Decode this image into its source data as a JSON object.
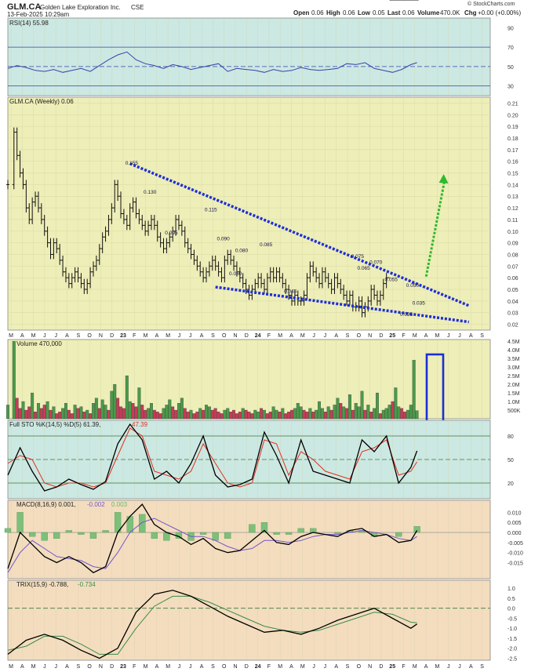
{
  "header": {
    "symbol": "GLM.CA",
    "company": "Golden Lake Exploration Inc.",
    "exchange": "CSE",
    "datetime": "13-Feb-2025 10:29am",
    "open_label": "Open",
    "open": "0.06",
    "high_label": "High",
    "high": "0.06",
    "low_label": "Low",
    "low": "0.05",
    "last_label": "Last",
    "last": "0.06",
    "volume_label": "Volume",
    "volume": "470.0K",
    "chg_label": "Chg",
    "chg": "+0.00 (+0.00%)",
    "copyright": "© StockCharts.com"
  },
  "x_axis": {
    "labels": [
      "M",
      "A",
      "M",
      "J",
      "J",
      "A",
      "S",
      "O",
      "N",
      "D",
      "23",
      "F",
      "M",
      "A",
      "M",
      "J",
      "J",
      "A",
      "S",
      "O",
      "N",
      "D",
      "24",
      "F",
      "M",
      "A",
      "M",
      "J",
      "J",
      "A",
      "S",
      "O",
      "N",
      "D",
      "25",
      "F",
      "M",
      "A",
      "M",
      "J",
      "J",
      "A",
      "S"
    ],
    "bold_labels": [
      "23",
      "24",
      "25"
    ]
  },
  "colors": {
    "price_bg": "#eeeeb8",
    "rsi_bg": "#cce8e2",
    "osc_bg": "#f3ddbe",
    "trend": "#1e2ed8",
    "arrow": "#2fb82f",
    "up": "#4a9a4a",
    "down": "#c63c58",
    "rsi_line": "#3344aa",
    "k_line": "#000000",
    "d_line": "#e03020",
    "hist": "#7cc07a",
    "macd_sig": "#7755cc",
    "trix_sig": "#3a8a4a"
  },
  "chart_data": [
    {
      "type": "line",
      "panel": "rsi",
      "legend": "RSI(14) 55.98",
      "ylim": [
        20,
        100
      ],
      "ticks": [
        30,
        50,
        70,
        90
      ],
      "levels": [
        30,
        50,
        70
      ],
      "x": [
        0,
        3,
        6,
        9,
        12,
        15,
        18,
        21,
        24,
        27,
        30,
        33,
        36,
        39,
        42,
        45,
        48,
        51,
        54,
        57,
        60,
        63,
        66,
        69,
        72,
        75,
        78,
        81,
        84,
        87,
        90,
        93,
        96,
        99,
        102,
        105,
        108,
        111,
        114,
        117,
        120,
        123,
        126,
        129,
        132,
        134
      ],
      "values": [
        48,
        51,
        49,
        46,
        45,
        47,
        44,
        46,
        48,
        45,
        51,
        57,
        62,
        65,
        57,
        53,
        51,
        48,
        52,
        50,
        47,
        49,
        51,
        53,
        45,
        48,
        47,
        46,
        44,
        47,
        45,
        46,
        49,
        47,
        46,
        47,
        48,
        53,
        52,
        54,
        48,
        46,
        44,
        47,
        52,
        54
      ]
    },
    {
      "type": "line",
      "panel": "price",
      "legend": "GLM.CA (Weekly) 0.06",
      "ylim": [
        0.015,
        0.215
      ],
      "ticks": [
        0.02,
        0.03,
        0.04,
        0.05,
        0.06,
        0.07,
        0.08,
        0.09,
        0.1,
        0.11,
        0.12,
        0.13,
        0.14,
        0.15,
        0.16,
        0.17,
        0.18,
        0.19,
        0.2,
        0.21
      ],
      "x": [
        0,
        2,
        3,
        4,
        5,
        6,
        7,
        8,
        9,
        10,
        11,
        12,
        13,
        14,
        15,
        16,
        17,
        18,
        19,
        20,
        21,
        22,
        23,
        24,
        25,
        26,
        27,
        28,
        29,
        30,
        31,
        32,
        33,
        34,
        35,
        36,
        37,
        38,
        39,
        40,
        41,
        42,
        43,
        44,
        45,
        46,
        47,
        48,
        49,
        50,
        51,
        52,
        53,
        54,
        55,
        56,
        57,
        58,
        59,
        60,
        61,
        62,
        63,
        64,
        65,
        66,
        67,
        68,
        69,
        70,
        71,
        72,
        73,
        74,
        75,
        76,
        77,
        78,
        79,
        80,
        81,
        82,
        83,
        84,
        85,
        86,
        87,
        88,
        89,
        90,
        91,
        92,
        93,
        94,
        95,
        96,
        97,
        98,
        99,
        100,
        101,
        102,
        103,
        104,
        105,
        106,
        107,
        108,
        109,
        110,
        111,
        112,
        113,
        114,
        115,
        116,
        117,
        118,
        119,
        120,
        121,
        122,
        123,
        124,
        125,
        126,
        127,
        128,
        129,
        130,
        131,
        132,
        133,
        134
      ],
      "values": [
        0.14,
        0.185,
        0.165,
        0.15,
        0.14,
        0.12,
        0.11,
        0.125,
        0.13,
        0.12,
        0.11,
        0.1,
        0.09,
        0.08,
        0.09,
        0.085,
        0.075,
        0.065,
        0.06,
        0.055,
        0.06,
        0.065,
        0.06,
        0.055,
        0.05,
        0.055,
        0.065,
        0.07,
        0.075,
        0.085,
        0.095,
        0.1,
        0.11,
        0.12,
        0.14,
        0.13,
        0.115,
        0.11,
        0.105,
        0.12,
        0.125,
        0.115,
        0.11,
        0.105,
        0.1,
        0.105,
        0.11,
        0.105,
        0.095,
        0.09,
        0.085,
        0.09,
        0.095,
        0.1,
        0.11,
        0.105,
        0.1,
        0.09,
        0.085,
        0.08,
        0.075,
        0.07,
        0.065,
        0.06,
        0.065,
        0.07,
        0.075,
        0.07,
        0.065,
        0.06,
        0.075,
        0.08,
        0.075,
        0.07,
        0.065,
        0.06,
        0.055,
        0.05,
        0.045,
        0.05,
        0.055,
        0.06,
        0.055,
        0.05,
        0.06,
        0.065,
        0.06,
        0.065,
        0.06,
        0.055,
        0.05,
        0.045,
        0.04,
        0.045,
        0.04,
        0.04,
        0.045,
        0.06,
        0.07,
        0.065,
        0.06,
        0.055,
        0.065,
        0.06,
        0.055,
        0.05,
        0.06,
        0.055,
        0.05,
        0.045,
        0.04,
        0.045,
        0.035,
        0.035,
        0.04,
        0.03,
        0.035,
        0.04,
        0.05,
        0.045,
        0.04,
        0.045,
        0.055,
        0.06
      ],
      "annotations": [
        {
          "x": 40,
          "y": 0.155,
          "label": "0.155"
        },
        {
          "x": 46,
          "y": 0.13,
          "label": "0.130"
        },
        {
          "x": 53,
          "y": 0.095,
          "label": "0.095"
        },
        {
          "x": 66,
          "y": 0.115,
          "label": "0.115"
        },
        {
          "x": 70,
          "y": 0.09,
          "label": "0.090"
        },
        {
          "x": 76,
          "y": 0.08,
          "label": "0.080"
        },
        {
          "x": 74,
          "y": 0.06,
          "label": "0.060"
        },
        {
          "x": 84,
          "y": 0.085,
          "label": "0.085"
        },
        {
          "x": 92,
          "y": 0.045,
          "label": "0.045"
        },
        {
          "x": 114,
          "y": 0.075,
          "label": "0.075"
        },
        {
          "x": 116,
          "y": 0.065,
          "label": "0.065"
        },
        {
          "x": 120,
          "y": 0.07,
          "label": "0.070"
        },
        {
          "x": 125,
          "y": 0.055,
          "label": "0.055"
        },
        {
          "x": 132,
          "y": 0.05,
          "label": "0.050"
        },
        {
          "x": 134,
          "y": 0.035,
          "label": "0.035"
        },
        {
          "x": 130,
          "y": 0.025,
          "label": "0.025"
        }
      ],
      "trendlines": [
        {
          "x1": 40,
          "y1": 0.158,
          "x2": 151,
          "y2": 0.036
        },
        {
          "x1": 68,
          "y1": 0.052,
          "x2": 151,
          "y2": 0.022
        }
      ],
      "arrow": {
        "x1": 137,
        "y1": 0.061,
        "x2": 143,
        "y2": 0.147
      }
    },
    {
      "type": "bar",
      "panel": "volume",
      "legend": "Volume 470,000",
      "ylim": [
        0,
        4.6
      ],
      "ticks": [
        0.5,
        1,
        1.5,
        2,
        2.5,
        3,
        3.5,
        4,
        4.5
      ],
      "tick_labels": [
        "500K",
        "1.0M",
        "1.5M",
        "2.0M",
        "2.5M",
        "3.0M",
        "3.5M",
        "4.0M",
        "4.5M"
      ],
      "x": [
        0,
        2,
        3,
        4,
        5,
        6,
        7,
        8,
        9,
        10,
        11,
        12,
        13,
        14,
        15,
        16,
        17,
        18,
        19,
        20,
        21,
        22,
        23,
        24,
        25,
        26,
        27,
        28,
        29,
        30,
        31,
        32,
        33,
        34,
        35,
        36,
        37,
        38,
        39,
        40,
        41,
        42,
        43,
        44,
        45,
        46,
        47,
        48,
        49,
        50,
        51,
        52,
        53,
        54,
        55,
        56,
        57,
        58,
        59,
        60,
        61,
        62,
        63,
        64,
        65,
        66,
        67,
        68,
        69,
        70,
        71,
        72,
        73,
        74,
        75,
        76,
        77,
        78,
        79,
        80,
        81,
        82,
        83,
        84,
        85,
        86,
        87,
        88,
        89,
        90,
        91,
        92,
        93,
        94,
        95,
        96,
        97,
        98,
        99,
        100,
        101,
        102,
        103,
        104,
        105,
        106,
        107,
        108,
        109,
        110,
        111,
        112,
        113,
        114,
        115,
        116,
        117,
        118,
        119,
        120,
        121,
        122,
        123,
        124,
        125,
        126,
        127,
        128,
        129,
        130,
        131,
        132,
        133,
        134
      ],
      "values": [
        0.8,
        4.5,
        1.2,
        0.6,
        1.0,
        0.5,
        0.7,
        1.5,
        0.4,
        0.9,
        0.6,
        0.8,
        1.0,
        0.5,
        0.7,
        0.3,
        0.4,
        0.6,
        0.9,
        0.5,
        0.3,
        0.8,
        0.6,
        0.7,
        0.4,
        0.5,
        0.3,
        0.9,
        1.2,
        0.6,
        1.1,
        0.8,
        0.5,
        1.6,
        2.0,
        1.2,
        0.7,
        0.6,
        2.5,
        1.0,
        0.9,
        0.7,
        1.8,
        0.8,
        0.5,
        0.6,
        0.9,
        0.5,
        0.4,
        0.3,
        0.6,
        0.8,
        1.1,
        0.7,
        0.5,
        0.9,
        1.2,
        0.6,
        0.4,
        0.5,
        0.3,
        0.4,
        0.6,
        0.5,
        0.8,
        0.7,
        0.5,
        0.6,
        0.4,
        0.3,
        0.5,
        0.6,
        0.4,
        0.5,
        0.3,
        0.4,
        0.6,
        0.5,
        0.4,
        0.3,
        0.5,
        0.4,
        0.6,
        0.5,
        0.3,
        0.4,
        0.7,
        0.5,
        0.4,
        0.6,
        0.3,
        0.4,
        0.5,
        0.6,
        0.9,
        0.7,
        0.5,
        0.4,
        0.6,
        0.4,
        0.5,
        1.0,
        0.6,
        0.4,
        0.7,
        0.5,
        0.8,
        1.2,
        0.9,
        0.7,
        0.6,
        1.4,
        0.5,
        0.9,
        0.7,
        1.6,
        0.5,
        0.8,
        0.4,
        0.6,
        1.5,
        0.3,
        0.5,
        0.6,
        0.8,
        1.0,
        1.8,
        0.7,
        0.6,
        0.4,
        0.5,
        0.8,
        3.4,
        0.47
      ],
      "up_down": [
        1,
        1,
        0,
        0,
        1,
        0,
        0,
        1,
        0,
        1,
        0,
        0,
        1,
        0,
        1,
        0,
        0,
        1,
        1,
        0,
        0,
        1,
        0,
        1,
        0,
        1,
        0,
        1,
        1,
        0,
        1,
        1,
        0,
        1,
        1,
        0,
        0,
        0,
        1,
        1,
        0,
        0,
        1,
        0,
        0,
        1,
        1,
        0,
        0,
        0,
        1,
        1,
        1,
        0,
        0,
        1,
        1,
        0,
        0,
        1,
        0,
        0,
        1,
        0,
        1,
        1,
        0,
        0,
        0,
        0,
        1,
        1,
        0,
        0,
        0,
        0,
        1,
        0,
        0,
        0,
        1,
        1,
        0,
        1,
        0,
        0,
        1,
        1,
        0,
        1,
        0,
        0,
        0,
        1,
        1,
        1,
        0,
        0,
        1,
        0,
        1,
        1,
        1,
        0,
        1,
        0,
        1,
        1,
        0,
        1,
        0,
        1,
        0,
        1,
        1,
        1,
        0,
        1,
        0,
        1,
        1,
        0,
        1,
        1,
        1,
        0,
        1,
        1,
        0,
        0,
        1,
        1,
        1,
        1
      ]
    },
    {
      "type": "line",
      "panel": "sto",
      "legend_k": "Full STO %K(14,5) %D(5) 61.39,",
      "legend_d": "47.39",
      "ylim": [
        0,
        100
      ],
      "ticks": [
        20,
        50,
        80
      ],
      "levels": [
        20,
        50,
        80
      ],
      "x": [
        0,
        4,
        8,
        12,
        16,
        20,
        24,
        28,
        32,
        36,
        40,
        44,
        48,
        52,
        56,
        60,
        64,
        68,
        72,
        76,
        80,
        84,
        88,
        92,
        96,
        100,
        104,
        108,
        112,
        116,
        120,
        124,
        128,
        132,
        134
      ],
      "k": [
        30,
        65,
        35,
        10,
        15,
        25,
        18,
        12,
        22,
        70,
        95,
        75,
        25,
        35,
        20,
        45,
        80,
        30,
        15,
        18,
        25,
        85,
        55,
        20,
        75,
        35,
        30,
        25,
        20,
        75,
        60,
        80,
        20,
        40,
        61
      ],
      "d": [
        45,
        55,
        50,
        20,
        15,
        20,
        20,
        15,
        20,
        55,
        90,
        80,
        35,
        30,
        25,
        35,
        70,
        45,
        20,
        15,
        20,
        75,
        70,
        30,
        60,
        50,
        35,
        30,
        25,
        60,
        65,
        75,
        30,
        35,
        47
      ]
    },
    {
      "type": "line",
      "panel": "macd",
      "legend": "MACD(8,16,9) 0.001,",
      "legend_sig": "-0.002",
      "legend_hist": "0.003",
      "ylim": [
        -0.023,
        0.016
      ],
      "ticks": [
        -0.015,
        -0.01,
        -0.005,
        0.0,
        0.005,
        0.01
      ],
      "tick_labels": [
        "-0.015",
        "-0.010",
        "-0.005",
        "0.000",
        "0.005",
        "0.010"
      ],
      "x": [
        0,
        4,
        8,
        12,
        16,
        20,
        24,
        28,
        32,
        36,
        40,
        44,
        48,
        52,
        56,
        60,
        64,
        68,
        72,
        76,
        80,
        84,
        88,
        92,
        96,
        100,
        104,
        108,
        112,
        116,
        120,
        124,
        128,
        132,
        134
      ],
      "macd": [
        -0.018,
        0.0,
        -0.006,
        -0.012,
        -0.015,
        -0.012,
        -0.015,
        -0.02,
        -0.017,
        0.0,
        0.008,
        0.014,
        0.004,
        0.0,
        -0.002,
        -0.006,
        -0.003,
        -0.008,
        -0.01,
        -0.009,
        -0.004,
        0.001,
        -0.005,
        -0.006,
        -0.002,
        0.0,
        -0.001,
        -0.002,
        0.001,
        0.002,
        -0.002,
        -0.001,
        -0.005,
        -0.004,
        0.001
      ],
      "signal": [
        -0.02,
        -0.01,
        -0.004,
        -0.008,
        -0.012,
        -0.013,
        -0.014,
        -0.017,
        -0.018,
        -0.01,
        0.0,
        0.005,
        0.007,
        0.004,
        0.001,
        -0.002,
        -0.002,
        -0.004,
        -0.007,
        -0.009,
        -0.008,
        -0.004,
        -0.004,
        -0.005,
        -0.004,
        -0.002,
        -0.001,
        -0.001,
        0.0,
        0.001,
        0.0,
        -0.001,
        -0.003,
        -0.004,
        -0.002
      ]
    },
    {
      "type": "line",
      "panel": "trix",
      "legend": "TRIX(15,9) -0.788,",
      "legend_sig": "-0.734",
      "ylim": [
        -2.6,
        1.4
      ],
      "ticks": [
        -2.5,
        -2.0,
        -1.5,
        -1.0,
        -0.5,
        0.0,
        0.5,
        1.0
      ],
      "tick_labels": [
        "-2.5",
        "-2.0",
        "-1.5",
        "-1.0",
        "-0.5",
        "0.0",
        "0.5",
        "1.0"
      ],
      "x": [
        0,
        6,
        12,
        18,
        24,
        30,
        36,
        42,
        48,
        54,
        60,
        66,
        72,
        78,
        84,
        90,
        96,
        102,
        108,
        114,
        120,
        126,
        132,
        134
      ],
      "trix": [
        -2.3,
        -1.6,
        -1.3,
        -1.6,
        -2.1,
        -2.5,
        -2.0,
        -0.2,
        0.7,
        0.9,
        0.6,
        0.1,
        -0.4,
        -0.8,
        -1.2,
        -1.1,
        -1.3,
        -1.0,
        -0.6,
        -0.3,
        0.0,
        -0.5,
        -1.0,
        -0.79
      ],
      "signal": [
        -2.1,
        -1.9,
        -1.4,
        -1.4,
        -1.8,
        -2.3,
        -2.3,
        -1.0,
        0.1,
        0.6,
        0.6,
        0.3,
        -0.1,
        -0.5,
        -0.9,
        -1.1,
        -1.2,
        -1.1,
        -0.8,
        -0.5,
        -0.2,
        -0.3,
        -0.7,
        -0.73
      ]
    }
  ]
}
